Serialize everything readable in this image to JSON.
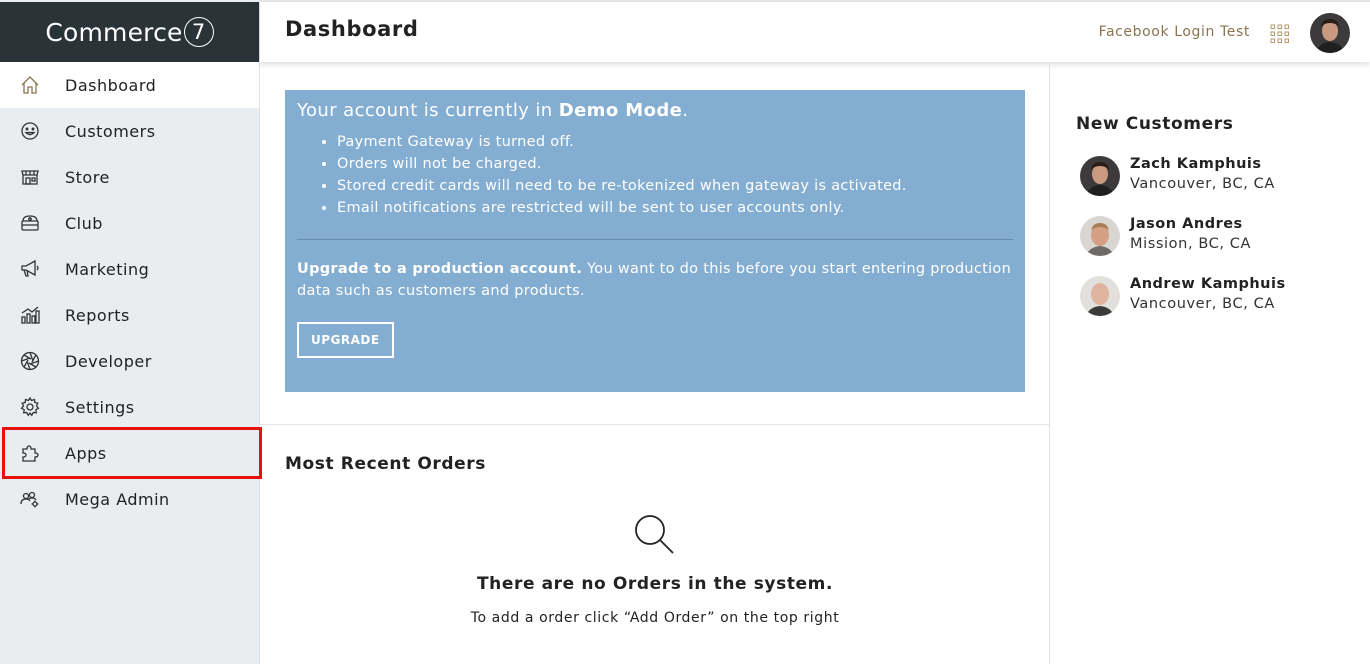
{
  "app": {
    "brand_name": "Commerce",
    "brand_mark": "7"
  },
  "header": {
    "title": "Dashboard",
    "account_name": "Facebook Login Test",
    "apps_grid_icon": "grid-icon",
    "avatar_icon": "user-avatar"
  },
  "sidebar": {
    "items": [
      {
        "label": "Dashboard",
        "icon": "home-icon",
        "active": true
      },
      {
        "label": "Customers",
        "icon": "smiley-icon"
      },
      {
        "label": "Store",
        "icon": "storefront-icon"
      },
      {
        "label": "Club",
        "icon": "club-icon"
      },
      {
        "label": "Marketing",
        "icon": "megaphone-icon"
      },
      {
        "label": "Reports",
        "icon": "bar-chart-icon"
      },
      {
        "label": "Developer",
        "icon": "aperture-icon"
      },
      {
        "label": "Settings",
        "icon": "gear-icon"
      },
      {
        "label": "Apps",
        "icon": "puzzle-icon",
        "highlighted": true
      },
      {
        "label": "Mega Admin",
        "icon": "users-gear-icon"
      }
    ],
    "highlight_color": "#e8100f"
  },
  "demo_banner": {
    "title_prefix": "Your account is currently in ",
    "title_bold": "Demo Mode",
    "title_suffix": ".",
    "bullets": [
      "Payment Gateway is turned off.",
      "Orders will not be charged.",
      "Stored credit cards will need to be re-tokenized when gateway is activated.",
      "Email notifications are restricted will be sent to user accounts only."
    ],
    "upgrade_bold": "Upgrade to a production account.",
    "upgrade_text": " You want to do this before you start entering production data such as customers and products.",
    "upgrade_button": "UPGRADE",
    "background_color": "#84aed1"
  },
  "orders": {
    "title": "Most Recent Orders",
    "empty_icon": "search-icon",
    "empty_title": "There are no Orders in the system.",
    "empty_subtitle": "To add a order click “Add Order” on the top right"
  },
  "new_customers": {
    "title": "New Customers",
    "items": [
      {
        "name": "Zach Kamphuis",
        "location": "Vancouver, BC, CA"
      },
      {
        "name": "Jason Andres",
        "location": "Mission, BC, CA"
      },
      {
        "name": "Andrew Kamphuis",
        "location": "Vancouver, BC, CA"
      }
    ]
  },
  "colors": {
    "sidebar_bg": "#e9edf0",
    "logo_bar_bg": "#2a3338",
    "accent_gold": "#8c7451"
  }
}
